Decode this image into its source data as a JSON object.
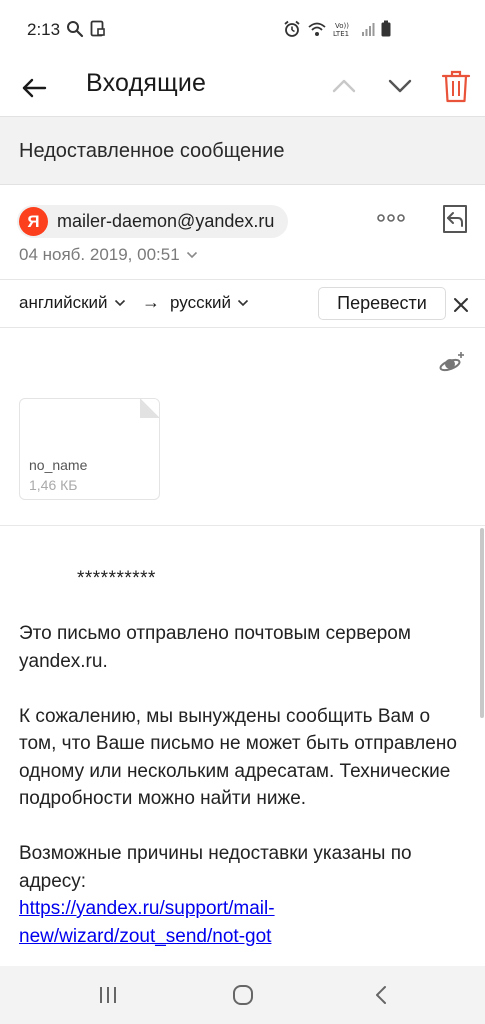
{
  "status_bar": {
    "time": "2:13",
    "left_icons": [
      "search-icon",
      "screenshot-icon"
    ],
    "right_icons": [
      "alarm-icon",
      "wifi-icon",
      "volte-icon",
      "signal-icon",
      "battery-icon"
    ],
    "volte_label": "Vo)) LTE1"
  },
  "toolbar": {
    "back_icon": "arrow-left-icon",
    "title": "Входящие",
    "prev_icon": "chevron-up-icon",
    "next_icon": "chevron-down-icon",
    "delete_icon": "trash-icon",
    "delete_color": "#e8533a"
  },
  "subject": "Недоставленное сообщение",
  "sender": {
    "avatar_letter": "Я",
    "avatar_color": "#fc3f1d",
    "email": "mailer-daemon@yandex.ru",
    "date": "04 нояб. 2019, 00:51",
    "more_icon": "more-dots-icon",
    "reply_icon": "reply-icon"
  },
  "translate": {
    "from_lang": "английский",
    "arrow": "→",
    "to_lang": "русский",
    "button_label": "Перевести",
    "close_icon": "close-icon"
  },
  "attachment": {
    "name": "no_name",
    "size": "1,46 КБ"
  },
  "body": {
    "stars": "**********",
    "para1": "Это письмо отправлено почтовым сервером yandex.ru.",
    "para2": "К сожалению, мы вынуждены сообщить Вам о том, что Ваше письмо не может быть отправлено одному или нескольким адресатам. Технические подробности можно найти ниже.",
    "para3": "Возможные причины недоставки указаны по адресу:",
    "link": "https://yandex.ru/support/mail-new/wizard/zout_send/not-got"
  },
  "nav_bar": {
    "recent_icon": "recent-apps-icon",
    "home_icon": "home-icon",
    "back_icon": "back-icon"
  }
}
